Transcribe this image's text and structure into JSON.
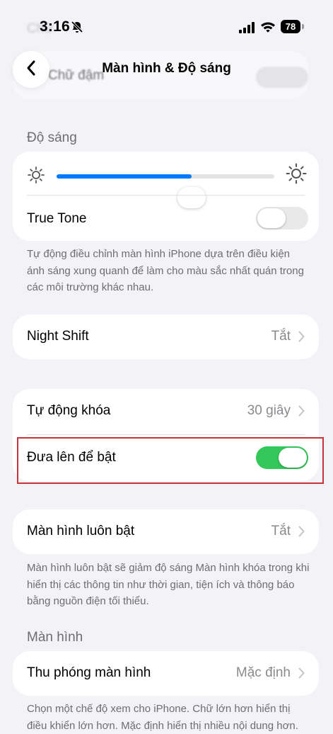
{
  "status_bar": {
    "time": "3:16",
    "battery": "78"
  },
  "background_ghost": {
    "top_text": "Chữ",
    "row_text": "Chữ đậm"
  },
  "nav": {
    "title": "Màn hình & Độ sáng"
  },
  "brightness": {
    "header": "Độ sáng",
    "slider_level": 0.62,
    "true_tone_label": "True Tone",
    "true_tone_on": false,
    "footnote": "Tự động điều chỉnh màn hình iPhone dựa trên điều kiện ánh sáng xung quanh để làm cho màu sắc nhất quán trong các môi trường khác nhau."
  },
  "night_shift": {
    "label": "Night Shift",
    "value": "Tắt"
  },
  "lock": {
    "auto_lock_label": "Tự động khóa",
    "auto_lock_value": "30 giây",
    "raise_to_wake_label": "Đưa lên để bật",
    "raise_to_wake_on": true
  },
  "always_on": {
    "label": "Màn hình luôn bật",
    "value": "Tắt",
    "footnote": "Màn hình luôn bật sẽ giảm độ sáng Màn hình khóa trong khi hiển thị các thông tin như thời gian, tiện ích và thông báo bằng nguồn điện tối thiểu."
  },
  "display": {
    "header": "Màn hình",
    "zoom_label": "Thu phóng màn hình",
    "zoom_value": "Mặc định",
    "footnote": "Chọn một chế độ xem cho iPhone. Chữ lớn hơn hiển thị điều khiển lớn hơn. Mặc định hiển thị nhiều nội dung hơn."
  },
  "colors": {
    "accent": "#007aff",
    "toggle_on": "#34c759",
    "highlight": "#c8343c"
  }
}
